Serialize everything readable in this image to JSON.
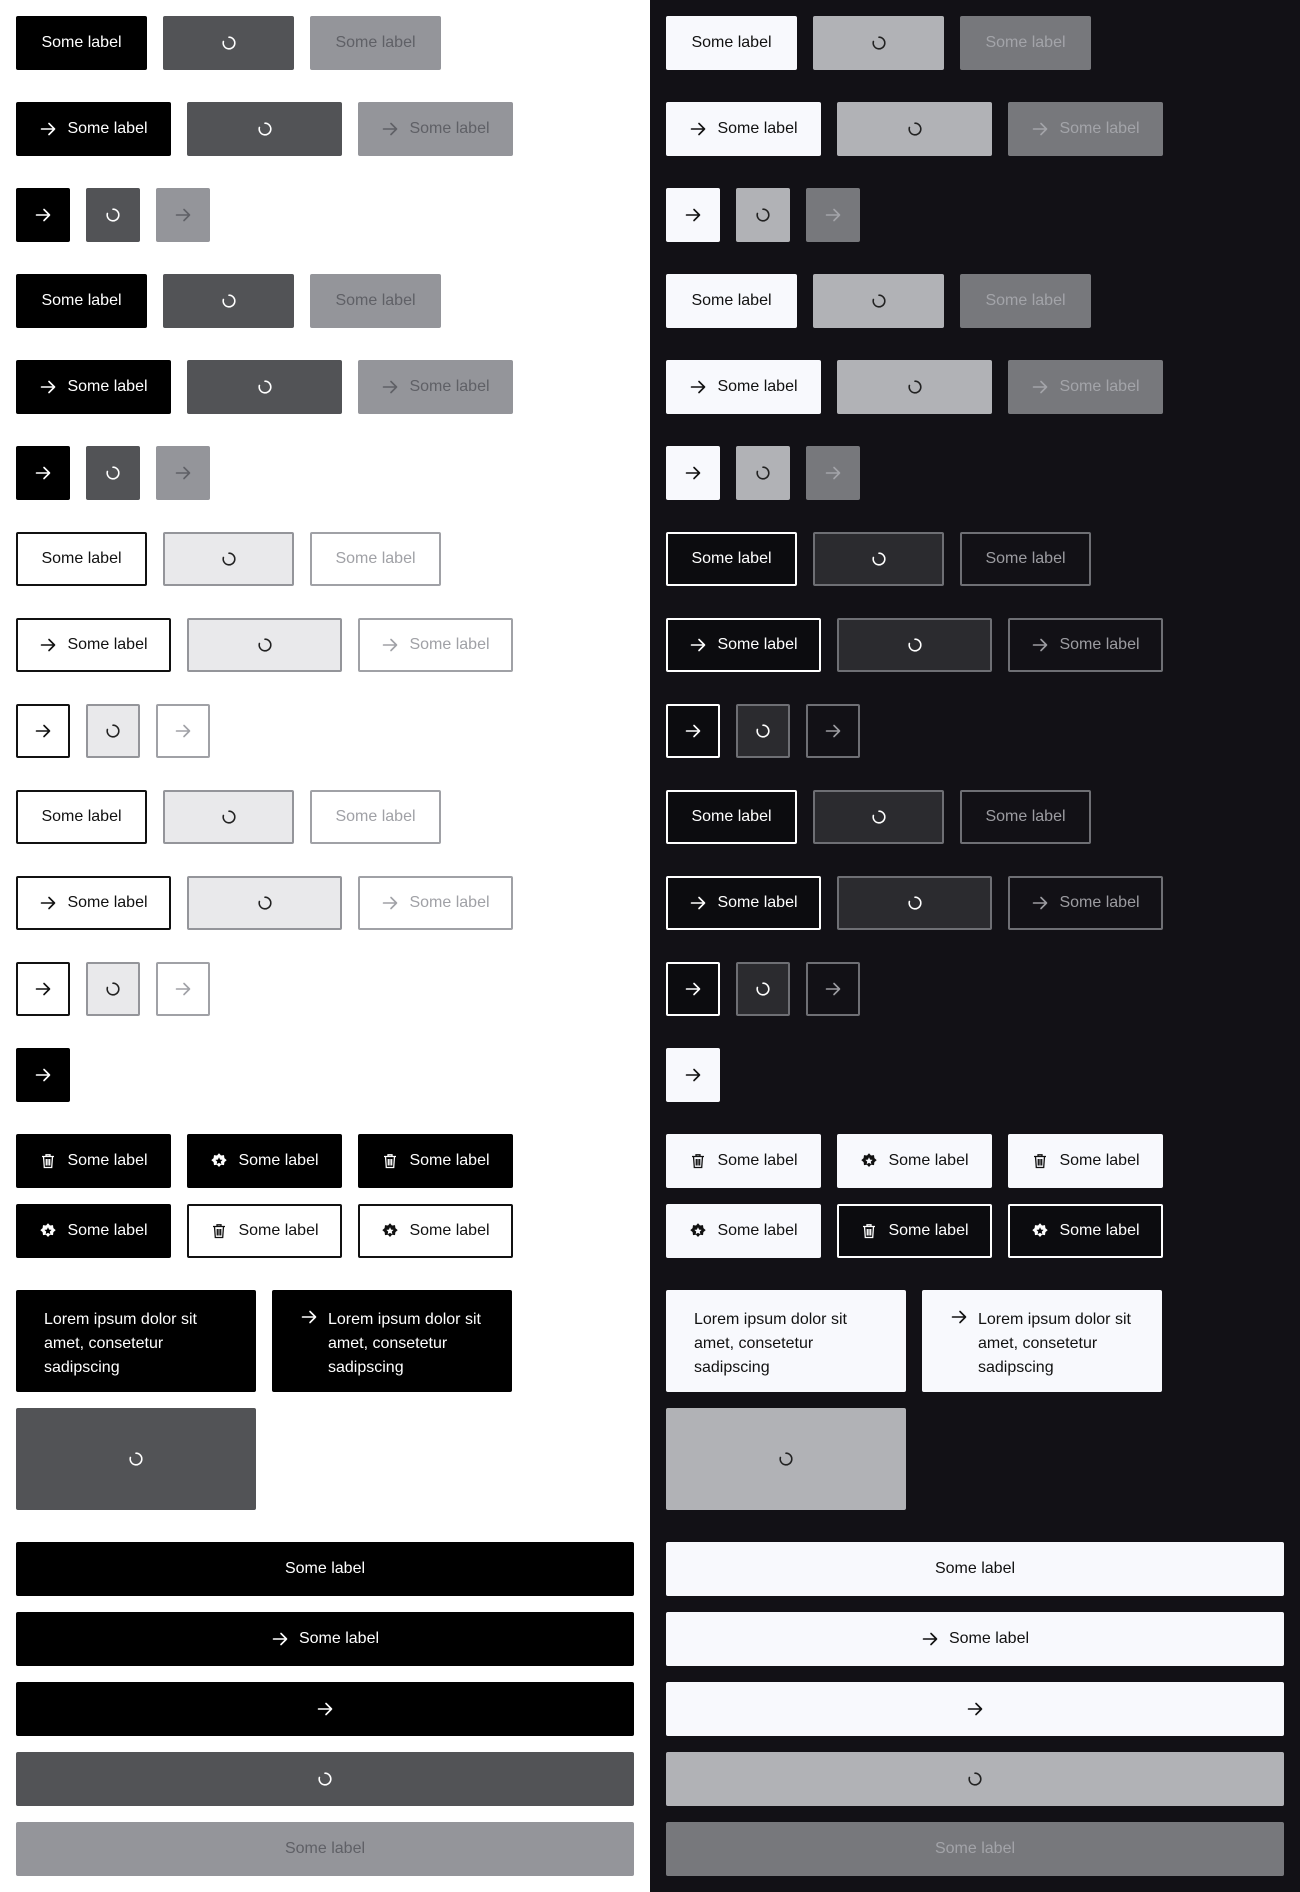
{
  "buttons": {
    "label": "Some label",
    "lorem": "Lorem ipsum dolor sit amet, consetetur sadipscing"
  },
  "themes": [
    "light",
    "dark"
  ],
  "colors": {
    "light_primary": "#000000",
    "light_loading": "#525356",
    "light_disabled": "#94959a",
    "dark_background": "#121116",
    "dark_primary": "#f8f9fd",
    "dark_loading": "#b1b2b6",
    "dark_disabled": "#77787c"
  },
  "icons": [
    "arrow-right-icon",
    "spinner-icon",
    "trash-icon",
    "badge-star-icon"
  ]
}
